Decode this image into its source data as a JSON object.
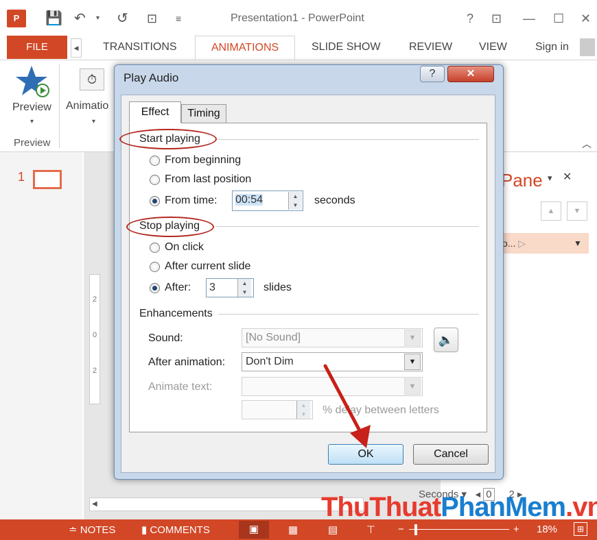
{
  "app": {
    "title": "Presentation1 - PowerPoint",
    "logo": "P"
  },
  "quick_access": {
    "save_icon": "save-icon",
    "undo_icon": "undo-icon",
    "redo_icon": "redo-icon",
    "slideshow_icon": "slideshow-icon"
  },
  "window_controls": {
    "help": "?",
    "restore": "⊡",
    "minimize": "—",
    "maximize": "☐",
    "close": "✕"
  },
  "tabs": {
    "file": "FILE",
    "items": [
      "TRANSITIONS",
      "ANIMATIONS",
      "SLIDE SHOW",
      "REVIEW",
      "VIEW"
    ],
    "active": "ANIMATIONS",
    "sign_in": "Sign in"
  },
  "ribbon": {
    "preview_label": "Preview",
    "preview_group": "Preview",
    "animation_label": "Animatio"
  },
  "slides": {
    "number": "1"
  },
  "pane": {
    "title": "Pane",
    "item_text": "o..."
  },
  "timeline": {
    "seconds_label": "Seconds",
    "start": "0",
    "end": "2"
  },
  "ruler": [
    "2",
    "0",
    "2"
  ],
  "dialog": {
    "title": "Play Audio",
    "help": "?",
    "tabs": [
      "Effect",
      "Timing"
    ],
    "start_playing": {
      "heading": "Start playing",
      "from_beginning": "From beginning",
      "from_last": "From last position",
      "from_time": "From time:",
      "time_value": "00:54",
      "seconds": "seconds",
      "selected": "from_time"
    },
    "stop_playing": {
      "heading": "Stop playing",
      "on_click": "On click",
      "after_current": "After current slide",
      "after": "After:",
      "after_value": "3",
      "slides": "slides",
      "selected": "after"
    },
    "enhancements": {
      "heading": "Enhancements",
      "sound_label": "Sound:",
      "sound_value": "[No Sound]",
      "after_anim_label": "After animation:",
      "after_anim_value": "Don't Dim",
      "animate_text_label": "Animate text:",
      "delay_label": "% delay between letters"
    },
    "ok": "OK",
    "cancel": "Cancel"
  },
  "status": {
    "notes": "NOTES",
    "comments": "COMMENTS",
    "zoom": "18%"
  },
  "watermark": {
    "part1": "ThuThuat",
    "part2": "PhanMem",
    "part3": ".vn"
  },
  "colors": {
    "accent": "#d24726",
    "selection": "#cde3f7",
    "annotation": "#b3271f"
  }
}
